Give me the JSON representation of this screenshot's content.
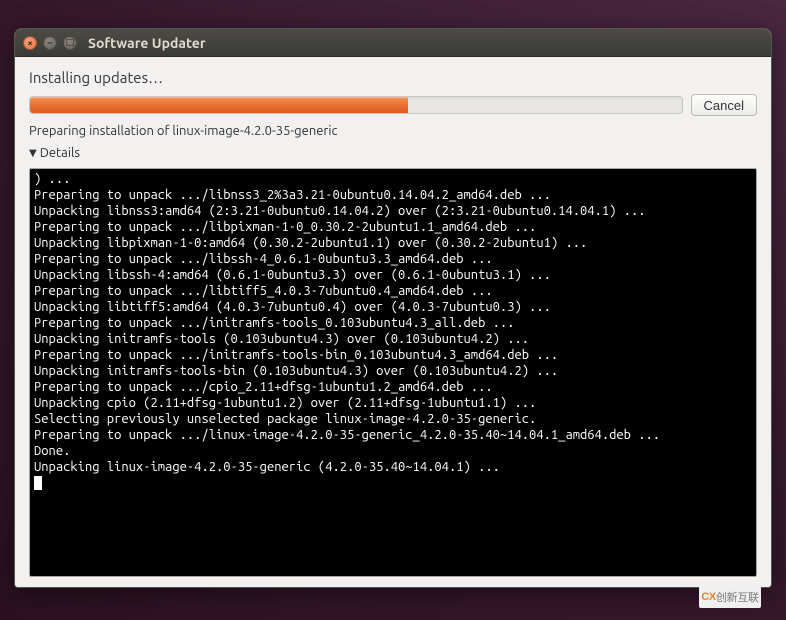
{
  "window": {
    "title": "Software Updater"
  },
  "heading": "Installing updates…",
  "progress": {
    "percent": 58
  },
  "buttons": {
    "cancel": "Cancel"
  },
  "status": "Preparing installation of linux-image-4.2.0-35-generic",
  "details": {
    "label": "Details",
    "expanded": true
  },
  "terminal_lines": [
    ") ...",
    "Preparing to unpack .../libnss3_2%3a3.21-0ubuntu0.14.04.2_amd64.deb ...",
    "Unpacking libnss3:amd64 (2:3.21-0ubuntu0.14.04.2) over (2:3.21-0ubuntu0.14.04.1) ...",
    "Preparing to unpack .../libpixman-1-0_0.30.2-2ubuntu1.1_amd64.deb ...",
    "Unpacking libpixman-1-0:amd64 (0.30.2-2ubuntu1.1) over (0.30.2-2ubuntu1) ...",
    "Preparing to unpack .../libssh-4_0.6.1-0ubuntu3.3_amd64.deb ...",
    "Unpacking libssh-4:amd64 (0.6.1-0ubuntu3.3) over (0.6.1-0ubuntu3.1) ...",
    "Preparing to unpack .../libtiff5_4.0.3-7ubuntu0.4_amd64.deb ...",
    "Unpacking libtiff5:amd64 (4.0.3-7ubuntu0.4) over (4.0.3-7ubuntu0.3) ...",
    "Preparing to unpack .../initramfs-tools_0.103ubuntu4.3_all.deb ...",
    "Unpacking initramfs-tools (0.103ubuntu4.3) over (0.103ubuntu4.2) ...",
    "Preparing to unpack .../initramfs-tools-bin_0.103ubuntu4.3_amd64.deb ...",
    "Unpacking initramfs-tools-bin (0.103ubuntu4.3) over (0.103ubuntu4.2) ...",
    "Preparing to unpack .../cpio_2.11+dfsg-1ubuntu1.2_amd64.deb ...",
    "Unpacking cpio (2.11+dfsg-1ubuntu1.2) over (2.11+dfsg-1ubuntu1.1) ...",
    "Selecting previously unselected package linux-image-4.2.0-35-generic.",
    "Preparing to unpack .../linux-image-4.2.0-35-generic_4.2.0-35.40~14.04.1_amd64.deb ...",
    "Done.",
    "Unpacking linux-image-4.2.0-35-generic (4.2.0-35.40~14.04.1) ..."
  ],
  "watermark": {
    "prefix": "CX",
    "text": "创新互联"
  }
}
